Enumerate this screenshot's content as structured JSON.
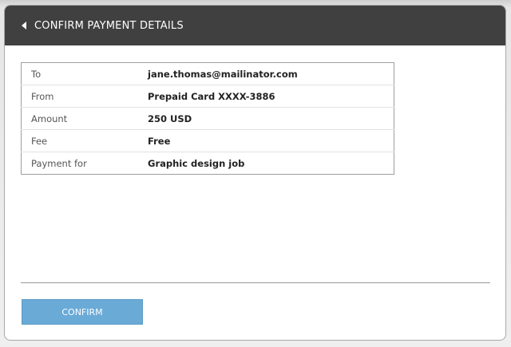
{
  "header": {
    "title": "CONFIRM PAYMENT DETAILS",
    "back_icon": "chevron-left-icon"
  },
  "details": [
    {
      "label": "To",
      "value": "jane.thomas@mailinator.com"
    },
    {
      "label": "From",
      "value": "Prepaid Card XXXX-3886"
    },
    {
      "label": "Amount",
      "value": "250 USD"
    },
    {
      "label": "Fee",
      "value": "Free"
    },
    {
      "label": "Payment for",
      "value": "Graphic design job"
    }
  ],
  "actions": {
    "confirm_label": "CONFIRM"
  },
  "colors": {
    "header_bg": "#404040",
    "button_bg": "#6aaad6"
  }
}
